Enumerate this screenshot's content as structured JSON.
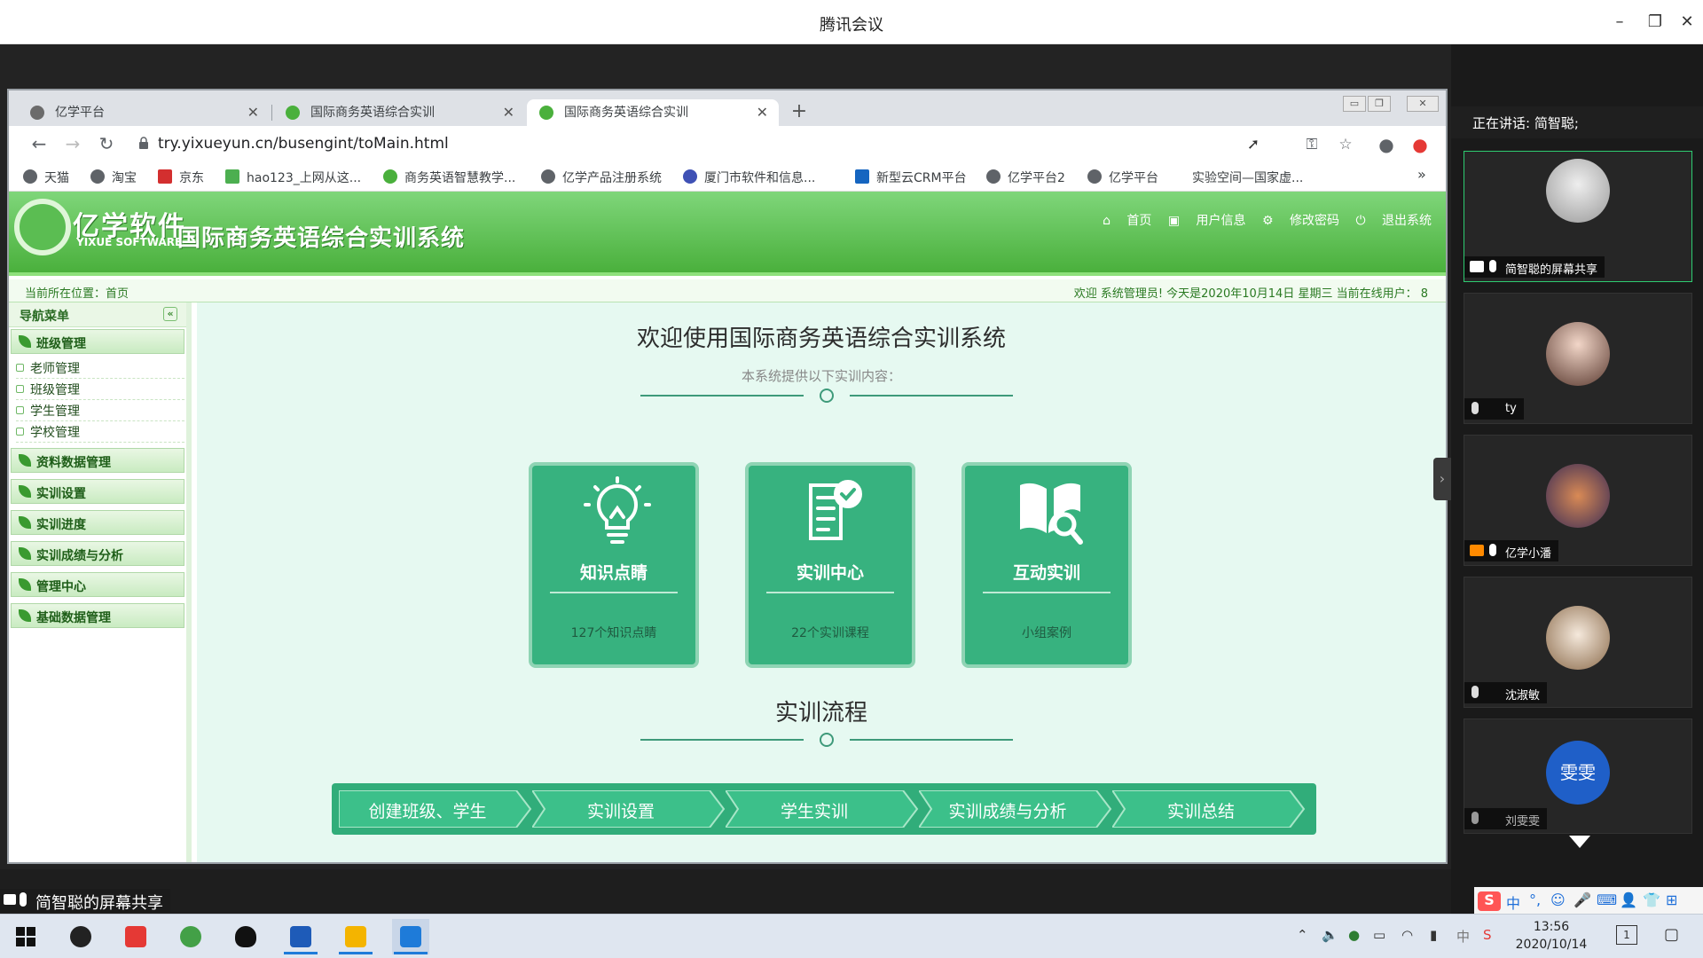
{
  "window": {
    "title": "腾讯会议"
  },
  "browser": {
    "tabs": [
      {
        "label": "亿学平台",
        "active": false
      },
      {
        "label": "国际商务英语综合实训",
        "active": false
      },
      {
        "label": "国际商务英语综合实训",
        "active": true
      }
    ],
    "url": "try.yixueyun.cn/busengint/toMain.html",
    "bookmarks": [
      "天猫",
      "淘宝",
      "京东",
      "hao123_上网从这...",
      "商务英语智慧教学...",
      "亿学产品注册系统",
      "厦门市软件和信息...",
      "新型云CRM平台",
      "亿学平台2",
      "亿学平台",
      "实验空间—国家虚..."
    ],
    "more_bookmarks": "»"
  },
  "site": {
    "logo_cn": "亿学软件",
    "logo_en": "YIXUE SOFTWARE",
    "system_title": "国际商务英语综合实训系统",
    "top_links": [
      "首页",
      "用户信息",
      "修改密码",
      "退出系统"
    ],
    "breadcrumb": "当前所在位置：首页",
    "status": "欢迎 系统管理员!   今天是2020年10月14日 星期三    当前在线用户：  8"
  },
  "sidebar": {
    "header": "导航菜单",
    "collapse": "«",
    "group_first": "班级管理",
    "subitems": [
      "老师管理",
      "班级管理",
      "学生管理",
      "学校管理"
    ],
    "groups": [
      "资料数据管理",
      "实训设置",
      "实训进度",
      "实训成绩与分析",
      "管理中心",
      "基础数据管理"
    ]
  },
  "content": {
    "welcome": "欢迎使用国际商务英语综合实训系统",
    "subline": "本系统提供以下实训内容：",
    "cards": [
      {
        "title": "知识点睛",
        "subtitle": "127个知识点睛"
      },
      {
        "title": "实训中心",
        "subtitle": "22个实训课程"
      },
      {
        "title": "互动实训",
        "subtitle": "小组案例"
      }
    ],
    "flow_title": "实训流程",
    "flow_steps": [
      "创建班级、学生",
      "实训设置",
      "学生实训",
      "实训成绩与分析",
      "实训总结"
    ]
  },
  "meeting": {
    "share_label": "简智聪的屏幕共享",
    "speaking": "正在讲话: 简智聪;",
    "participants": [
      {
        "name": "简智聪的屏幕共享",
        "active": true
      },
      {
        "name": "ty",
        "active": false
      },
      {
        "name": "亿学小潘",
        "active": false
      },
      {
        "name": "沈淑敏",
        "active": false
      },
      {
        "name": "刘雯雯",
        "active": false,
        "avatar_text": "雯雯"
      }
    ]
  },
  "ime": [
    "中",
    "°,",
    "☺",
    "🎤",
    "⌨",
    "👤",
    "👕",
    "⊞"
  ],
  "taskbar": {
    "time": "13:56",
    "date": "2020/10/14",
    "notification_count": "1"
  },
  "colors": {
    "accent": "#37b27f",
    "banner": "#4ab03c",
    "meeting_bg": "#1a1a1a"
  }
}
